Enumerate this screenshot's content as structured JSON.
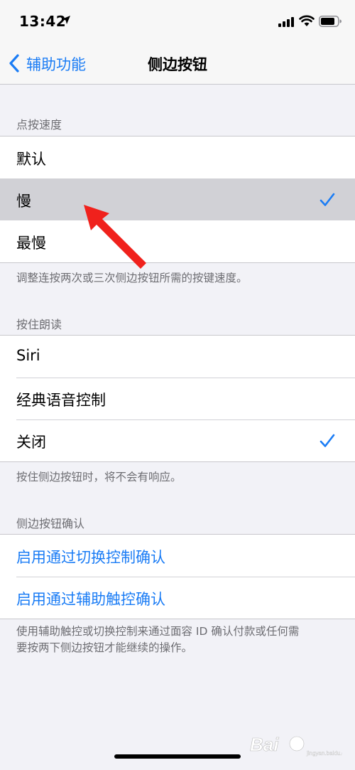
{
  "status_bar": {
    "time": "13:42",
    "icons": [
      "location-arrow-icon",
      "cellular-signal-icon",
      "wifi-icon",
      "battery-icon"
    ]
  },
  "nav": {
    "back_label": "辅助功能",
    "title": "侧边按钮"
  },
  "sections": [
    {
      "header": "点按速度",
      "items": [
        {
          "label": "默认",
          "checked": false
        },
        {
          "label": "慢",
          "checked": true,
          "highlighted": true
        },
        {
          "label": "最慢",
          "checked": false
        }
      ],
      "footer": "调整连按两次或三次侧边按钮所需的按键速度。"
    },
    {
      "header": "按住朗读",
      "items": [
        {
          "label": "Siri",
          "checked": false
        },
        {
          "label": "经典语音控制",
          "checked": false
        },
        {
          "label": "关闭",
          "checked": true
        }
      ],
      "footer": "按住侧边按钮时，将不会有响应。"
    },
    {
      "header": "侧边按钮确认",
      "items": [
        {
          "label": "启用通过切换控制确认"
        },
        {
          "label": "启用通过辅助触控确认"
        }
      ],
      "footer_lines": [
        "使用辅助触控或切换控制来通过面容 ID 确认付款或任何需",
        "要按两下侧边按钮才能继续的操作。"
      ]
    }
  ],
  "colors": {
    "accent": "#1a7cf5",
    "background": "#f2f2f7",
    "highlight_row": "#d1d1d6",
    "annotation_arrow": "#f0211c"
  },
  "watermark": {
    "text_main": "Bai",
    "text_sub": "jingyan.baidu.com"
  }
}
